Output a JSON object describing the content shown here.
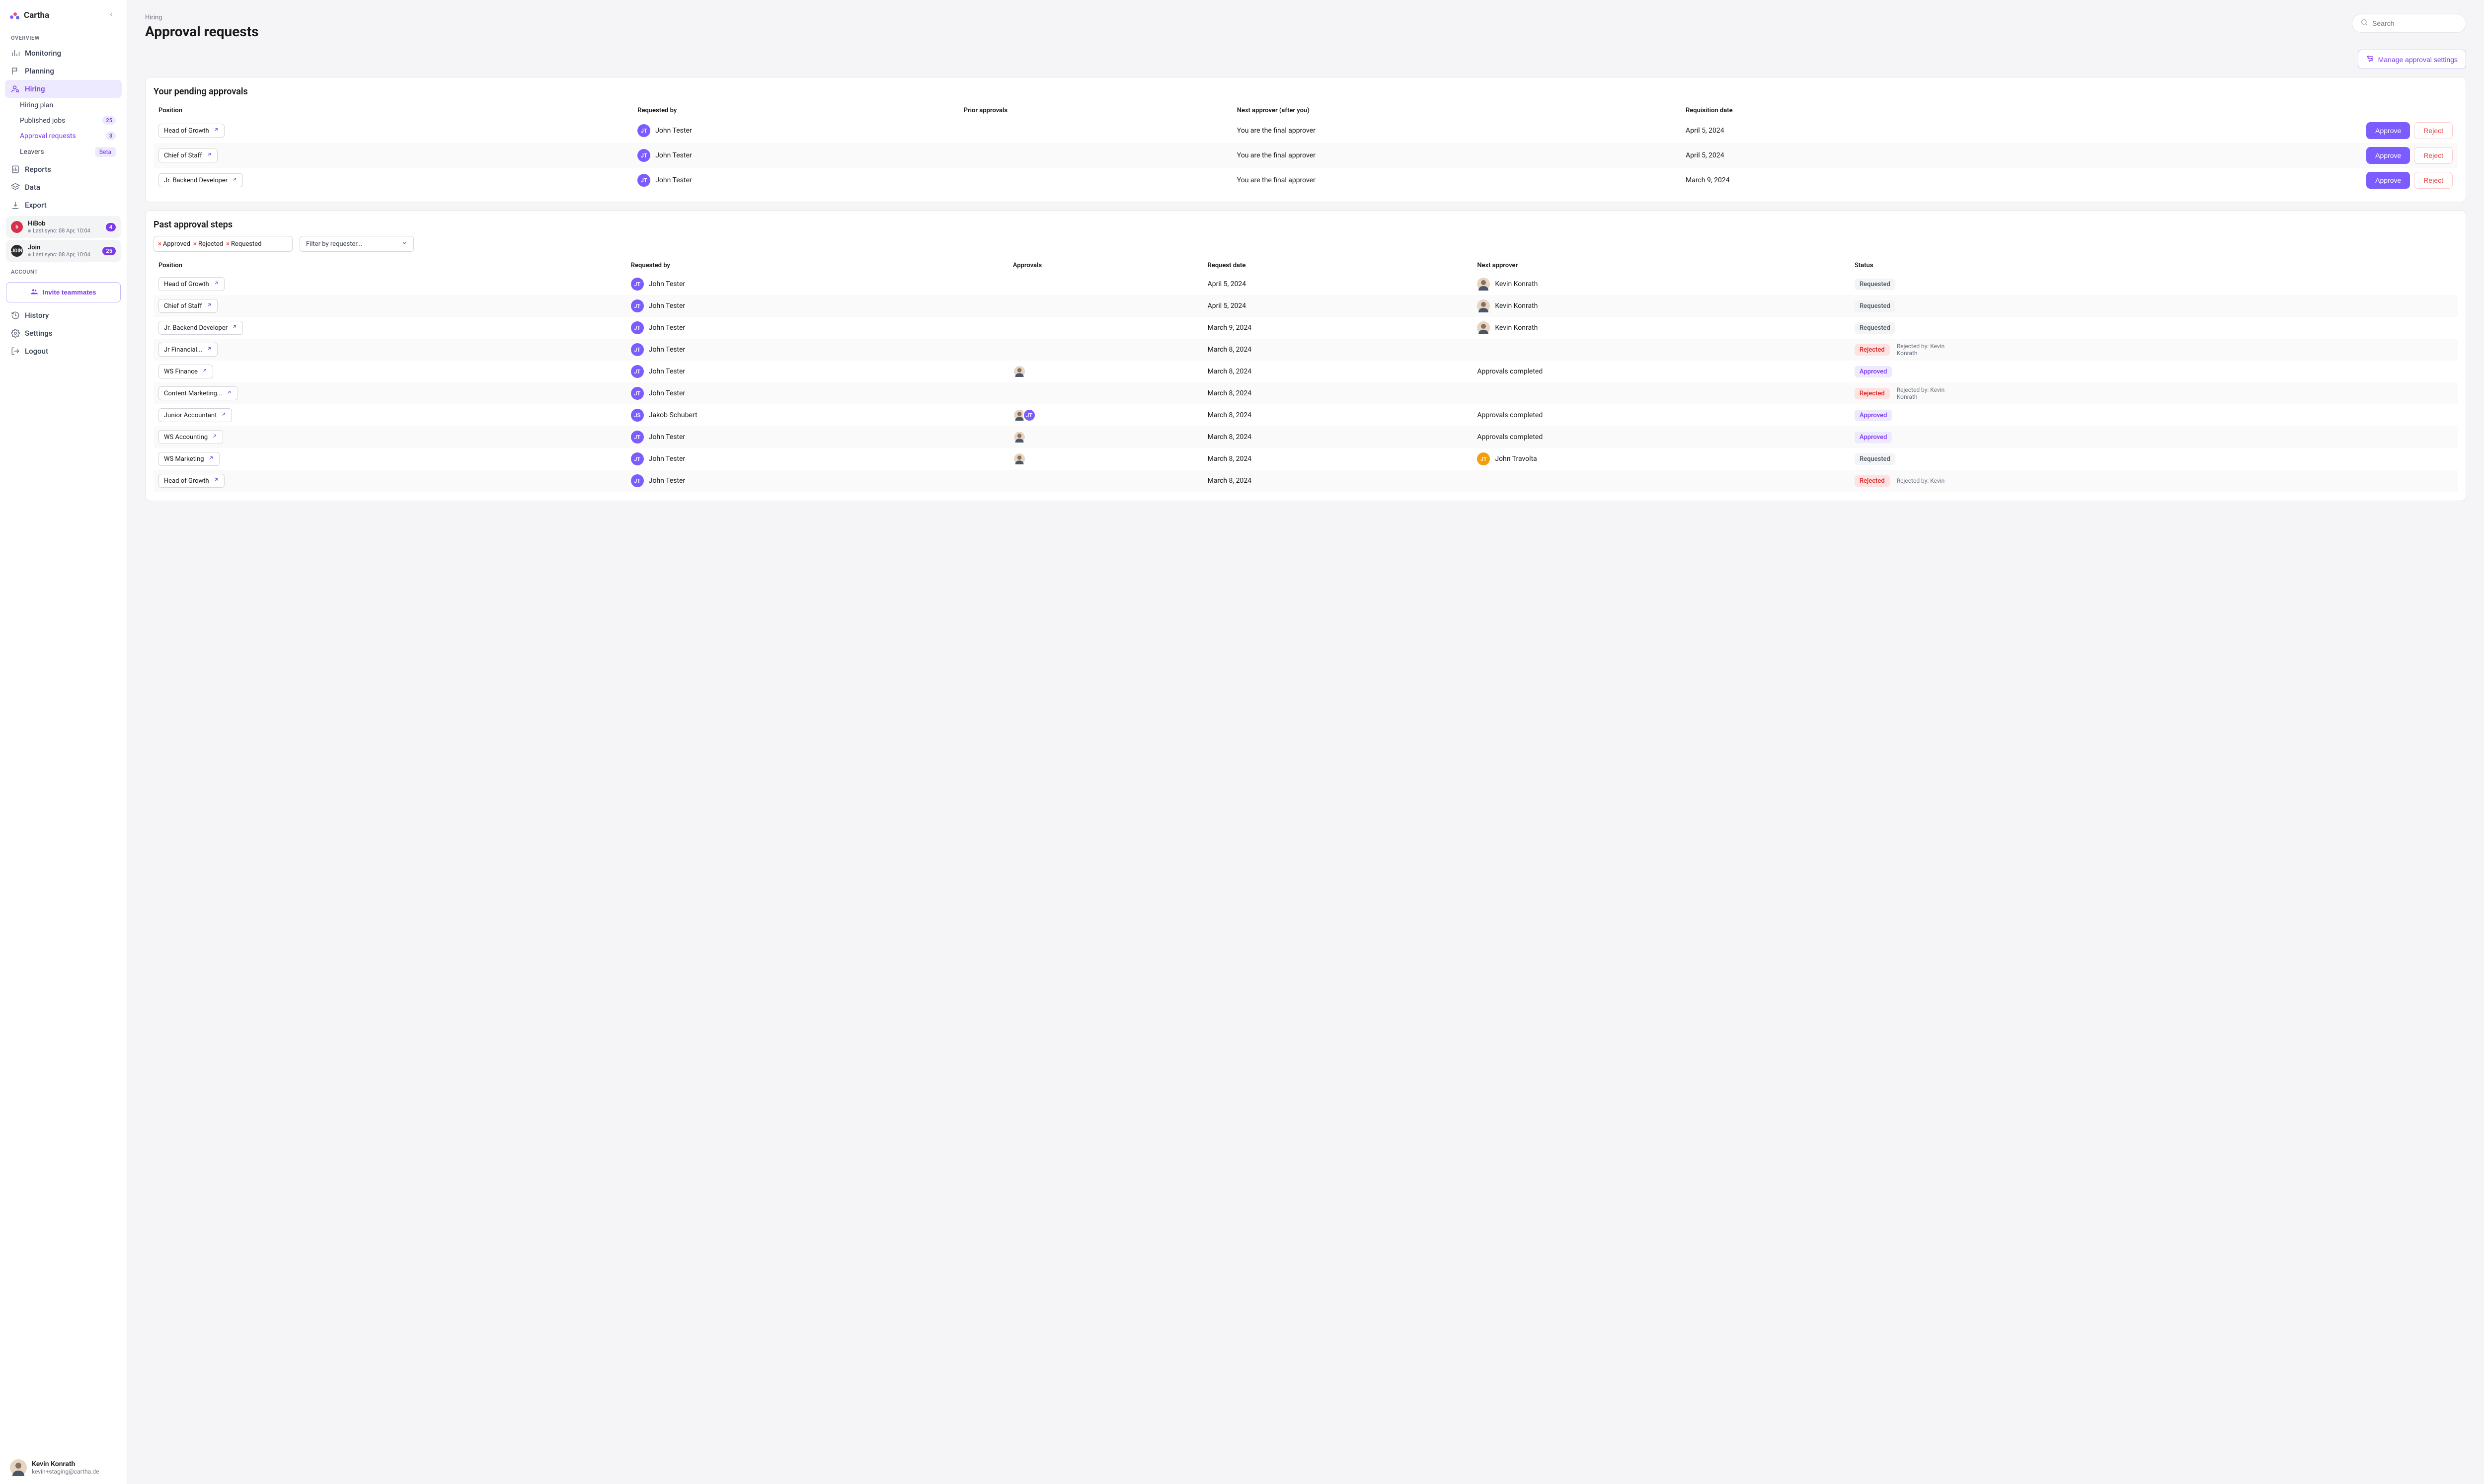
{
  "brand": {
    "name": "Cartha"
  },
  "sidebar": {
    "overview_label": "OVERVIEW",
    "account_label": "ACCOUNT",
    "items": {
      "monitoring": "Monitoring",
      "planning": "Planning",
      "hiring": "Hiring",
      "reports": "Reports",
      "data": "Data",
      "export": "Export",
      "history": "History",
      "settings": "Settings",
      "logout": "Logout"
    },
    "hiring_sub": {
      "plan": "Hiring plan",
      "published": "Published jobs",
      "published_count": "25",
      "approval": "Approval requests",
      "approval_count": "3",
      "leavers": "Leavers",
      "leavers_badge": "Beta"
    },
    "integrations": [
      {
        "name": "HiBob",
        "sync": "Last sync: 08 Apr, 10:04",
        "badge": "4",
        "icon_bg": "#d6304a",
        "icon_text": "b"
      },
      {
        "name": "Join",
        "sync": "Last sync: 08 Apr, 10:04",
        "badge": "25",
        "icon_bg": "#2b2b2b",
        "icon_text": "JOIN"
      }
    ],
    "invite_label": "Invite teammates"
  },
  "user": {
    "name": "Kevin Konrath",
    "email": "kevin+staging@cartha.de"
  },
  "page": {
    "breadcrumb": "Hiring",
    "title": "Approval requests",
    "search_placeholder": "Search",
    "manage_btn": "Manage approval settings"
  },
  "pending": {
    "title": "Your pending approvals",
    "columns": [
      "Position",
      "Requested by",
      "Prior approvals",
      "Next approver (after you)",
      "Requisition date"
    ],
    "approve_label": "Approve",
    "reject_label": "Reject",
    "rows": [
      {
        "position": "Head of Growth",
        "requested_by": "John Tester",
        "next": "You are the final approver",
        "date": "April 5, 2024"
      },
      {
        "position": "Chief of Staff",
        "requested_by": "John Tester",
        "next": "You are the final approver",
        "date": "April 5, 2024"
      },
      {
        "position": "Jr. Backend Developer",
        "requested_by": "John Tester",
        "next": "You are the final approver",
        "date": "March 9, 2024"
      }
    ]
  },
  "past": {
    "title": "Past approval steps",
    "filters": {
      "approved": "Approved",
      "rejected": "Rejected",
      "requested": "Requested",
      "requester_placeholder": "Filter by requester..."
    },
    "columns": [
      "Position",
      "Requested by",
      "Approvals",
      "Request date",
      "Next approver",
      "Status"
    ],
    "rows": [
      {
        "position": "Head of Growth",
        "requested_by": "John Tester",
        "req_initials": "JT",
        "approvals": [],
        "date": "April 5, 2024",
        "next_approver": "Kevin Konrath",
        "next_type": "photo",
        "status": "Requested"
      },
      {
        "position": "Chief of Staff",
        "requested_by": "John Tester",
        "req_initials": "JT",
        "approvals": [],
        "date": "April 5, 2024",
        "next_approver": "Kevin Konrath",
        "next_type": "photo",
        "status": "Requested"
      },
      {
        "position": "Jr. Backend Developer",
        "requested_by": "John Tester",
        "req_initials": "JT",
        "approvals": [],
        "date": "March 9, 2024",
        "next_approver": "Kevin Konrath",
        "next_type": "photo",
        "status": "Requested"
      },
      {
        "position": "Jr Financial...",
        "requested_by": "John Tester",
        "req_initials": "JT",
        "approvals": [],
        "date": "March 8, 2024",
        "next_approver": "",
        "status": "Rejected",
        "note": "Rejected by: Kevin Konrath"
      },
      {
        "position": "WS Finance",
        "requested_by": "John Tester",
        "req_initials": "JT",
        "approvals": [
          "photo"
        ],
        "date": "March 8, 2024",
        "next_approver": "Approvals completed",
        "next_type": "text",
        "status": "Approved"
      },
      {
        "position": "Content Marketing...",
        "requested_by": "John Tester",
        "req_initials": "JT",
        "approvals": [],
        "date": "March 8, 2024",
        "next_approver": "",
        "status": "Rejected",
        "note": "Rejected by: Kevin Konrath"
      },
      {
        "position": "Junior Accountant",
        "requested_by": "Jakob  Schubert",
        "req_initials": "JS",
        "approvals": [
          "photo",
          "JT"
        ],
        "date": "March 8, 2024",
        "next_approver": "Approvals completed",
        "next_type": "text",
        "status": "Approved"
      },
      {
        "position": "WS Accounting",
        "requested_by": "John Tester",
        "req_initials": "JT",
        "approvals": [
          "photo"
        ],
        "date": "March 8, 2024",
        "next_approver": "Approvals completed",
        "next_type": "text",
        "status": "Approved"
      },
      {
        "position": "WS Marketing",
        "requested_by": "John Tester",
        "req_initials": "JT",
        "approvals": [
          "photo"
        ],
        "date": "March 8, 2024",
        "next_approver": "John Travolta",
        "next_type": "initials",
        "next_initials": "JT",
        "next_bg": "orange",
        "status": "Requested"
      },
      {
        "position": "Head of Growth",
        "requested_by": "John Tester",
        "req_initials": "JT",
        "approvals": [],
        "date": "March 8, 2024",
        "next_approver": "",
        "status": "Rejected",
        "note": "Rejected by: Kevin"
      }
    ]
  }
}
